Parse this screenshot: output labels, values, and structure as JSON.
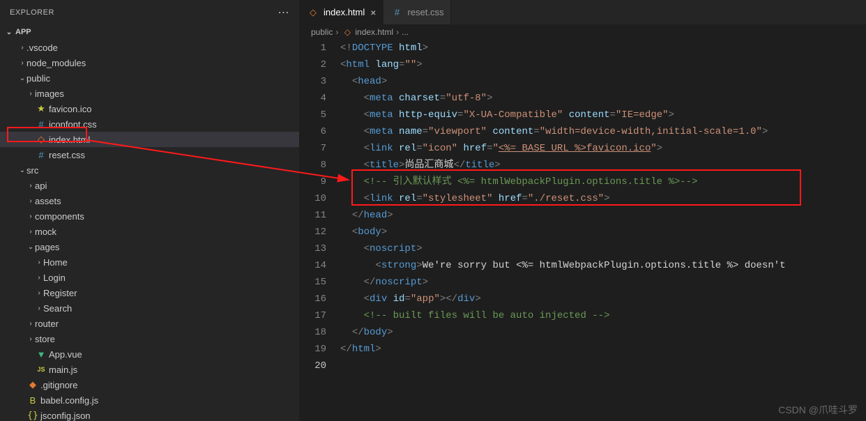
{
  "explorer": {
    "title": "EXPLORER"
  },
  "project": {
    "name": "APP"
  },
  "tree": [
    {
      "depth": 1,
      "chev": ">",
      "icon": "folder",
      "label": ".vscode"
    },
    {
      "depth": 1,
      "chev": ">",
      "icon": "folder",
      "label": "node_modules"
    },
    {
      "depth": 1,
      "chev": "v",
      "icon": "folder",
      "label": "public"
    },
    {
      "depth": 2,
      "chev": ">",
      "icon": "folder",
      "label": "images"
    },
    {
      "depth": 2,
      "chev": "",
      "icon": "favicon",
      "label": "favicon.ico"
    },
    {
      "depth": 2,
      "chev": "",
      "icon": "css",
      "label": "iconfont.css"
    },
    {
      "depth": 2,
      "chev": "",
      "icon": "html",
      "label": "index.html",
      "active": true,
      "highlighted": true
    },
    {
      "depth": 2,
      "chev": "",
      "icon": "css",
      "label": "reset.css"
    },
    {
      "depth": 1,
      "chev": "v",
      "icon": "folder",
      "label": "src"
    },
    {
      "depth": 2,
      "chev": ">",
      "icon": "folder",
      "label": "api"
    },
    {
      "depth": 2,
      "chev": ">",
      "icon": "folder",
      "label": "assets"
    },
    {
      "depth": 2,
      "chev": ">",
      "icon": "folder",
      "label": "components"
    },
    {
      "depth": 2,
      "chev": ">",
      "icon": "folder",
      "label": "mock"
    },
    {
      "depth": 2,
      "chev": "v",
      "icon": "folder",
      "label": "pages"
    },
    {
      "depth": 3,
      "chev": ">",
      "icon": "folder",
      "label": "Home"
    },
    {
      "depth": 3,
      "chev": ">",
      "icon": "folder",
      "label": "Login"
    },
    {
      "depth": 3,
      "chev": ">",
      "icon": "folder",
      "label": "Register"
    },
    {
      "depth": 3,
      "chev": ">",
      "icon": "folder",
      "label": "Search"
    },
    {
      "depth": 2,
      "chev": ">",
      "icon": "folder",
      "label": "router"
    },
    {
      "depth": 2,
      "chev": ">",
      "icon": "folder",
      "label": "store"
    },
    {
      "depth": 2,
      "chev": "",
      "icon": "vue",
      "label": "App.vue"
    },
    {
      "depth": 2,
      "chev": "",
      "icon": "js",
      "label": "main.js"
    },
    {
      "depth": 1,
      "chev": "",
      "icon": "git",
      "label": ".gitignore"
    },
    {
      "depth": 1,
      "chev": "",
      "icon": "babel",
      "label": "babel.config.js"
    },
    {
      "depth": 1,
      "chev": "",
      "icon": "json",
      "label": "jsconfig.json"
    }
  ],
  "tabs": [
    {
      "icon": "html",
      "label": "index.html",
      "active": true,
      "close": true
    },
    {
      "icon": "css",
      "label": "reset.css",
      "active": false,
      "close": false
    }
  ],
  "breadcrumb": {
    "seg1": "public",
    "seg2": "index.html",
    "seg3": "..."
  },
  "code": {
    "l1": {
      "doctype": "DOCTYPE",
      "html": "html"
    },
    "l2": {
      "tag": "html",
      "attr": "lang",
      "val": "\"\""
    },
    "l3": {
      "tag": "head"
    },
    "l4": {
      "tag": "meta",
      "a1": "charset",
      "v1": "\"utf-8\""
    },
    "l5": {
      "tag": "meta",
      "a1": "http-equiv",
      "v1": "\"X-UA-Compatible\"",
      "a2": "content",
      "v2": "\"IE=edge\""
    },
    "l6": {
      "tag": "meta",
      "a1": "name",
      "v1": "\"viewport\"",
      "a2": "content",
      "v2": "\"width=device-width,initial-scale=1.0\""
    },
    "l7": {
      "tag": "link",
      "a1": "rel",
      "v1": "\"icon\"",
      "a2": "href",
      "v2a": "\"",
      "v2b": "<%= BASE_URL %>",
      "v2c": "favicon.ico",
      "v2d": "\""
    },
    "l8": {
      "tag": "title",
      "text": "尚品汇商城"
    },
    "l9": {
      "comment": "<!-- 引入默认样式 <%= htmlWebpackPlugin.options.title %>-->"
    },
    "l10": {
      "tag": "link",
      "a1": "rel",
      "v1": "\"stylesheet\"",
      "a2": "href",
      "v2": "\"./reset.css\""
    },
    "l11": {
      "tag": "head"
    },
    "l12": {
      "tag": "body"
    },
    "l13": {
      "tag": "noscript"
    },
    "l14": {
      "tag": "strong",
      "text": "We're sorry but <%= htmlWebpackPlugin.options.title %> doesn't"
    },
    "l15": {
      "tag": "noscript"
    },
    "l16": {
      "tag": "div",
      "a1": "id",
      "v1": "\"app\""
    },
    "l17": {
      "comment": "<!-- built files will be auto injected -->"
    },
    "l18": {
      "tag": "body"
    },
    "l19": {
      "tag": "html"
    }
  },
  "watermark": "CSDN @爪哇斗罗"
}
